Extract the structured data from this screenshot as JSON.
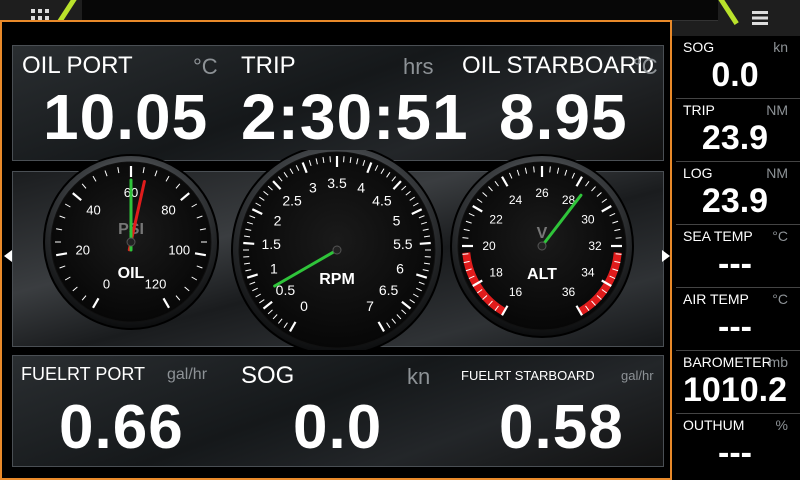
{
  "topbar": {
    "apps_icon": "grid-icon",
    "menu_icon": "hamburger-icon",
    "accent_color": "#b9e22b"
  },
  "panel_border_color": "#e98a2a",
  "top_row": {
    "oil_port": {
      "label": "OIL PORT",
      "unit": "°C",
      "value": "10.05"
    },
    "trip": {
      "label": "TRIP",
      "unit": "hrs",
      "value": "2:30:51"
    },
    "oil_starboard": {
      "label": "OIL STARBOARD",
      "unit": "°C",
      "value": "8.95"
    }
  },
  "gauges": {
    "oil": {
      "title": "OIL",
      "subtitle": "PSI",
      "ticks": [
        "0",
        "20",
        "40",
        "60",
        "80",
        "100",
        "120"
      ],
      "needle_green": 60,
      "needle_red": 65
    },
    "rpm": {
      "title": "RPM",
      "ticks": [
        "0",
        "0.5",
        "1",
        "1.5",
        "2",
        "2.5",
        "3",
        "3.5",
        "4",
        "4.5",
        "5",
        "5.5",
        "6",
        "6.5",
        "7"
      ],
      "needle": 0.7
    },
    "alt": {
      "title": "ALT",
      "subtitle": "V",
      "ticks": [
        "16",
        "18",
        "20",
        "22",
        "24",
        "26",
        "28",
        "30",
        "32",
        "34",
        "36"
      ],
      "needle": 28.5,
      "danger_color": "#e01c1c",
      "needle_color": "#2fc43a"
    }
  },
  "bottom_row": {
    "fuel_port": {
      "label": "FUELRT PORT",
      "unit": "gal/hr",
      "value": "0.66"
    },
    "sog": {
      "label": "SOG",
      "unit": "kn",
      "value": "0.0"
    },
    "fuel_starboard": {
      "label": "FUELRT STARBOARD",
      "unit": "gal/hr",
      "value": "0.58"
    }
  },
  "sidebar": [
    {
      "label": "SOG",
      "unit": "kn",
      "value": "0.0"
    },
    {
      "label": "TRIP",
      "unit": "NM",
      "value": "23.9"
    },
    {
      "label": "LOG",
      "unit": "NM",
      "value": "23.9"
    },
    {
      "label": "SEA TEMP",
      "unit": "°C",
      "value": "---"
    },
    {
      "label": "AIR TEMP",
      "unit": "°C",
      "value": "---"
    },
    {
      "label": "BAROMETER",
      "unit": "mb",
      "value": "1010.2"
    },
    {
      "label": "OUTHUM",
      "unit": "%",
      "value": "---"
    }
  ]
}
